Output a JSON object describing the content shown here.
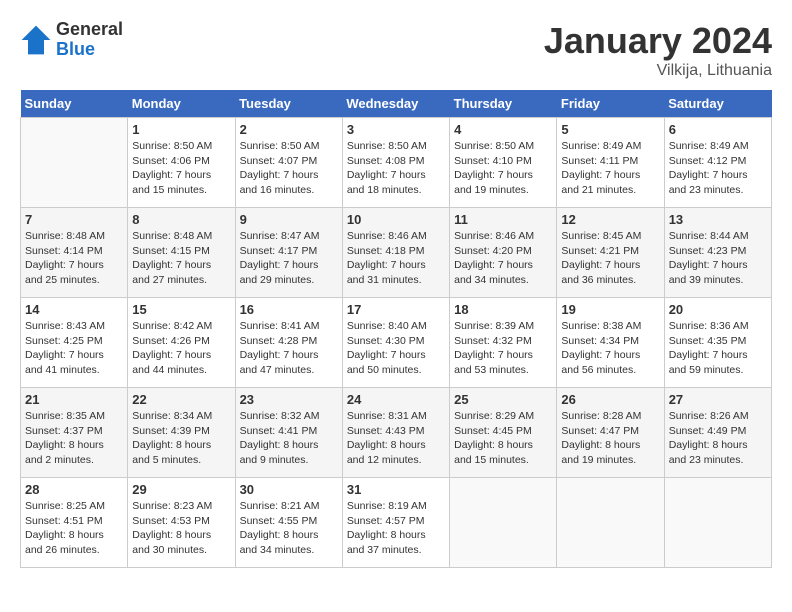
{
  "logo": {
    "general": "General",
    "blue": "Blue"
  },
  "title": "January 2024",
  "location": "Vilkija, Lithuania",
  "days_of_week": [
    "Sunday",
    "Monday",
    "Tuesday",
    "Wednesday",
    "Thursday",
    "Friday",
    "Saturday"
  ],
  "weeks": [
    [
      {
        "num": "",
        "sunrise": "",
        "sunset": "",
        "daylight": ""
      },
      {
        "num": "1",
        "sunrise": "Sunrise: 8:50 AM",
        "sunset": "Sunset: 4:06 PM",
        "daylight": "Daylight: 7 hours and 15 minutes."
      },
      {
        "num": "2",
        "sunrise": "Sunrise: 8:50 AM",
        "sunset": "Sunset: 4:07 PM",
        "daylight": "Daylight: 7 hours and 16 minutes."
      },
      {
        "num": "3",
        "sunrise": "Sunrise: 8:50 AM",
        "sunset": "Sunset: 4:08 PM",
        "daylight": "Daylight: 7 hours and 18 minutes."
      },
      {
        "num": "4",
        "sunrise": "Sunrise: 8:50 AM",
        "sunset": "Sunset: 4:10 PM",
        "daylight": "Daylight: 7 hours and 19 minutes."
      },
      {
        "num": "5",
        "sunrise": "Sunrise: 8:49 AM",
        "sunset": "Sunset: 4:11 PM",
        "daylight": "Daylight: 7 hours and 21 minutes."
      },
      {
        "num": "6",
        "sunrise": "Sunrise: 8:49 AM",
        "sunset": "Sunset: 4:12 PM",
        "daylight": "Daylight: 7 hours and 23 minutes."
      }
    ],
    [
      {
        "num": "7",
        "sunrise": "Sunrise: 8:48 AM",
        "sunset": "Sunset: 4:14 PM",
        "daylight": "Daylight: 7 hours and 25 minutes."
      },
      {
        "num": "8",
        "sunrise": "Sunrise: 8:48 AM",
        "sunset": "Sunset: 4:15 PM",
        "daylight": "Daylight: 7 hours and 27 minutes."
      },
      {
        "num": "9",
        "sunrise": "Sunrise: 8:47 AM",
        "sunset": "Sunset: 4:17 PM",
        "daylight": "Daylight: 7 hours and 29 minutes."
      },
      {
        "num": "10",
        "sunrise": "Sunrise: 8:46 AM",
        "sunset": "Sunset: 4:18 PM",
        "daylight": "Daylight: 7 hours and 31 minutes."
      },
      {
        "num": "11",
        "sunrise": "Sunrise: 8:46 AM",
        "sunset": "Sunset: 4:20 PM",
        "daylight": "Daylight: 7 hours and 34 minutes."
      },
      {
        "num": "12",
        "sunrise": "Sunrise: 8:45 AM",
        "sunset": "Sunset: 4:21 PM",
        "daylight": "Daylight: 7 hours and 36 minutes."
      },
      {
        "num": "13",
        "sunrise": "Sunrise: 8:44 AM",
        "sunset": "Sunset: 4:23 PM",
        "daylight": "Daylight: 7 hours and 39 minutes."
      }
    ],
    [
      {
        "num": "14",
        "sunrise": "Sunrise: 8:43 AM",
        "sunset": "Sunset: 4:25 PM",
        "daylight": "Daylight: 7 hours and 41 minutes."
      },
      {
        "num": "15",
        "sunrise": "Sunrise: 8:42 AM",
        "sunset": "Sunset: 4:26 PM",
        "daylight": "Daylight: 7 hours and 44 minutes."
      },
      {
        "num": "16",
        "sunrise": "Sunrise: 8:41 AM",
        "sunset": "Sunset: 4:28 PM",
        "daylight": "Daylight: 7 hours and 47 minutes."
      },
      {
        "num": "17",
        "sunrise": "Sunrise: 8:40 AM",
        "sunset": "Sunset: 4:30 PM",
        "daylight": "Daylight: 7 hours and 50 minutes."
      },
      {
        "num": "18",
        "sunrise": "Sunrise: 8:39 AM",
        "sunset": "Sunset: 4:32 PM",
        "daylight": "Daylight: 7 hours and 53 minutes."
      },
      {
        "num": "19",
        "sunrise": "Sunrise: 8:38 AM",
        "sunset": "Sunset: 4:34 PM",
        "daylight": "Daylight: 7 hours and 56 minutes."
      },
      {
        "num": "20",
        "sunrise": "Sunrise: 8:36 AM",
        "sunset": "Sunset: 4:35 PM",
        "daylight": "Daylight: 7 hours and 59 minutes."
      }
    ],
    [
      {
        "num": "21",
        "sunrise": "Sunrise: 8:35 AM",
        "sunset": "Sunset: 4:37 PM",
        "daylight": "Daylight: 8 hours and 2 minutes."
      },
      {
        "num": "22",
        "sunrise": "Sunrise: 8:34 AM",
        "sunset": "Sunset: 4:39 PM",
        "daylight": "Daylight: 8 hours and 5 minutes."
      },
      {
        "num": "23",
        "sunrise": "Sunrise: 8:32 AM",
        "sunset": "Sunset: 4:41 PM",
        "daylight": "Daylight: 8 hours and 9 minutes."
      },
      {
        "num": "24",
        "sunrise": "Sunrise: 8:31 AM",
        "sunset": "Sunset: 4:43 PM",
        "daylight": "Daylight: 8 hours and 12 minutes."
      },
      {
        "num": "25",
        "sunrise": "Sunrise: 8:29 AM",
        "sunset": "Sunset: 4:45 PM",
        "daylight": "Daylight: 8 hours and 15 minutes."
      },
      {
        "num": "26",
        "sunrise": "Sunrise: 8:28 AM",
        "sunset": "Sunset: 4:47 PM",
        "daylight": "Daylight: 8 hours and 19 minutes."
      },
      {
        "num": "27",
        "sunrise": "Sunrise: 8:26 AM",
        "sunset": "Sunset: 4:49 PM",
        "daylight": "Daylight: 8 hours and 23 minutes."
      }
    ],
    [
      {
        "num": "28",
        "sunrise": "Sunrise: 8:25 AM",
        "sunset": "Sunset: 4:51 PM",
        "daylight": "Daylight: 8 hours and 26 minutes."
      },
      {
        "num": "29",
        "sunrise": "Sunrise: 8:23 AM",
        "sunset": "Sunset: 4:53 PM",
        "daylight": "Daylight: 8 hours and 30 minutes."
      },
      {
        "num": "30",
        "sunrise": "Sunrise: 8:21 AM",
        "sunset": "Sunset: 4:55 PM",
        "daylight": "Daylight: 8 hours and 34 minutes."
      },
      {
        "num": "31",
        "sunrise": "Sunrise: 8:19 AM",
        "sunset": "Sunset: 4:57 PM",
        "daylight": "Daylight: 8 hours and 37 minutes."
      },
      {
        "num": "",
        "sunrise": "",
        "sunset": "",
        "daylight": ""
      },
      {
        "num": "",
        "sunrise": "",
        "sunset": "",
        "daylight": ""
      },
      {
        "num": "",
        "sunrise": "",
        "sunset": "",
        "daylight": ""
      }
    ]
  ]
}
